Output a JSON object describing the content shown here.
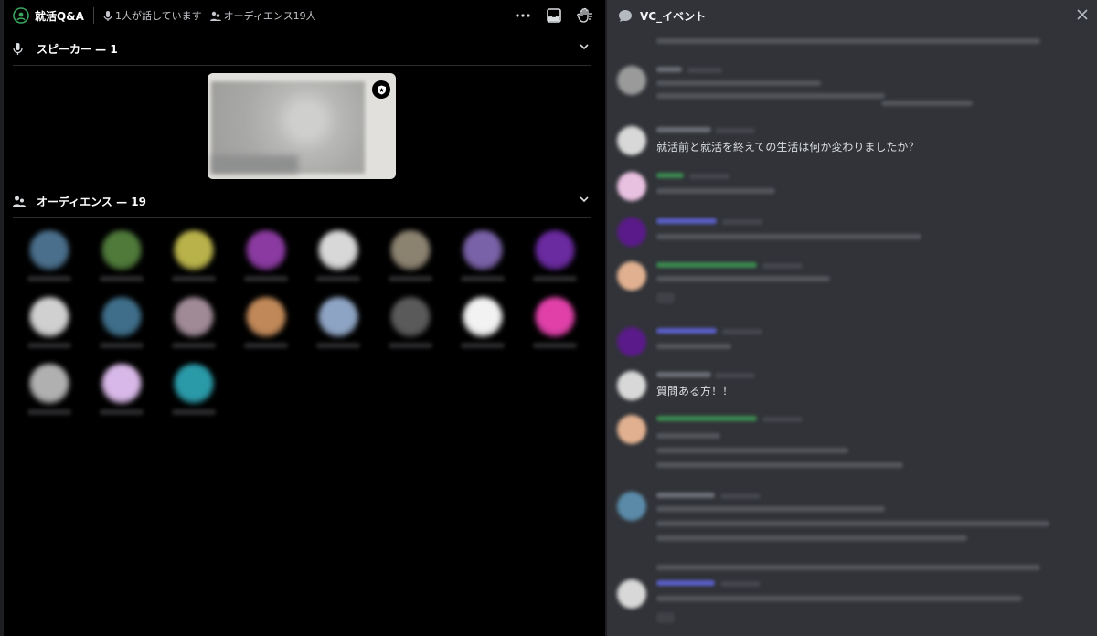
{
  "stage": {
    "title": "就活Q&A",
    "speaking_status": "1人が話しています",
    "audience_status": "オーディエンス19人",
    "icons": [
      "stage-icon",
      "mic-icon",
      "audience-icon",
      "more-icon",
      "inbox-icon",
      "raise-hand-icon"
    ],
    "speakers_section": {
      "label": "スピーカー — 1",
      "icon": "mic-icon"
    },
    "audience_section": {
      "label": "オーディエンス — 19",
      "icon": "audience-icon"
    },
    "speaker_badge_icon": "shield-icon",
    "audience_avatars": [
      "#4a6f8c",
      "#4f7a3a",
      "#b9b24a",
      "#8a3aa0",
      "#d8d8d8",
      "#8c8270",
      "#7a62a8",
      "#6a2aa0",
      "#d0d0d0",
      "#3f6e8a",
      "#a08a96",
      "#c08858",
      "#8ea4c4",
      "#5a5a5a",
      "#f2f2f2",
      "#e040a8",
      "#b0b0b0",
      "#d8b8e8",
      "#2a9aa8"
    ]
  },
  "chat": {
    "channel_name": "VC_イベント",
    "icons": [
      "chat-bubble-icon",
      "close-icon"
    ],
    "messages": [
      {
        "text": "就活前と就活を終えての生活は何か変わりましたか？"
      },
      {
        "text": "質問ある方！！"
      }
    ]
  },
  "colors": {
    "stage_bg": "#000000",
    "chat_bg": "#313338",
    "accent_green": "#3ba55d"
  }
}
